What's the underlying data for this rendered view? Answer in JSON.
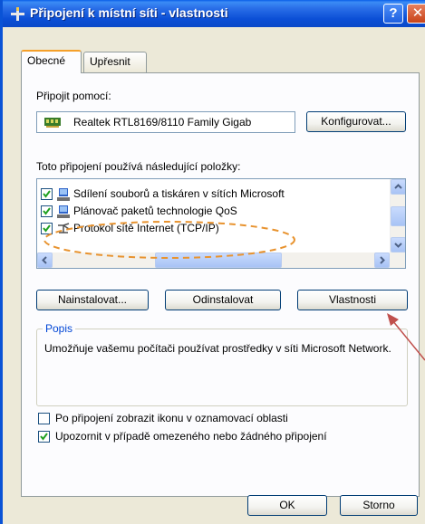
{
  "window": {
    "title": "Připojení k místní síti - vlastnosti",
    "help_label": "?",
    "close_label": "✕"
  },
  "tabs": [
    {
      "label": "Obecné",
      "active": true
    },
    {
      "label": "Upřesnit",
      "active": false
    }
  ],
  "connect_using": {
    "label": "Připojit pomocí:",
    "adapter": "Realtek RTL8169/8110 Family Gigab",
    "configure_label": "Konfigurovat..."
  },
  "items": {
    "label": "Toto připojení používá následující položky:",
    "list": [
      {
        "label": "Sdílení souborů a tiskáren v sítích Microsoft",
        "checked": true,
        "icon": "network-service-icon"
      },
      {
        "label": "Plánovač paketů technologie QoS",
        "checked": true,
        "icon": "network-service-icon"
      },
      {
        "label": "Protokol sítě Internet (TCP/IP)",
        "checked": true,
        "icon": "protocol-icon"
      }
    ]
  },
  "buttons": {
    "install": "Nainstalovat...",
    "uninstall": "Odinstalovat",
    "properties": "Vlastnosti"
  },
  "description": {
    "title": "Popis",
    "text": "Umožňuje vašemu počítači používat prostředky v síti Microsoft Network."
  },
  "options": [
    {
      "label": "Po připojení zobrazit ikonu v oznamovací oblasti",
      "checked": false
    },
    {
      "label": "Upozornit v případě omezeného nebo žádného připojení",
      "checked": true
    }
  ],
  "footer": {
    "ok": "OK",
    "cancel": "Storno"
  },
  "colors": {
    "titlebar": "#0b4fd6",
    "annotation": "#e8932f",
    "arrow": "#c0504d"
  }
}
